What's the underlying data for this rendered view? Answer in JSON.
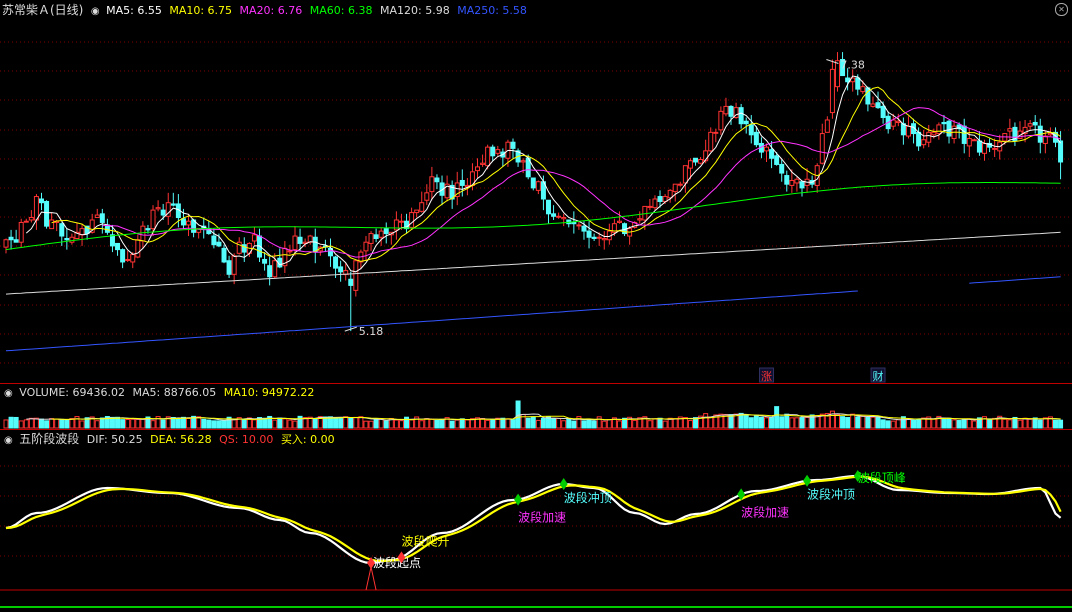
{
  "main_header": {
    "title": "苏常柴Ａ(日线)",
    "items": [
      {
        "label": "MA5: 6.55",
        "color": "#ffffff"
      },
      {
        "label": "MA10: 6.75",
        "color": "#ffff00"
      },
      {
        "label": "MA20: 6.76",
        "color": "#ff33ff"
      },
      {
        "label": "MA60: 6.38",
        "color": "#00ff00"
      },
      {
        "label": "MA120: 5.98",
        "color": "#dcdcdc"
      },
      {
        "label": "MA250: 5.58",
        "color": "#3355ff"
      }
    ]
  },
  "volume_header": {
    "items": [
      {
        "label": "VOLUME: 69436.02",
        "color": "#dcdcdc"
      },
      {
        "label": "MA5: 88766.05",
        "color": "#dcdcdc"
      },
      {
        "label": "MA10: 94972.22",
        "color": "#ffff00"
      }
    ]
  },
  "indicator_header": {
    "title": "五阶段波段",
    "items": [
      {
        "label": "DIF: 50.25",
        "color": "#dcdcdc"
      },
      {
        "label": "DEA: 56.28",
        "color": "#ffff00"
      },
      {
        "label": "QS: 10.00",
        "color": "#ff3333"
      },
      {
        "label": "买入: 0.00",
        "color": "#ffff00"
      }
    ]
  },
  "colors": {
    "up": "#ff3333",
    "down": "#54fcfc",
    "grid": "#800000",
    "divider": "#c00000"
  },
  "chart_data": [
    {
      "type": "candlestick",
      "title": "苏常柴Ａ(日线)",
      "ylim": [
        4.8,
        7.7
      ],
      "series": [
        {
          "name": "MA5",
          "values": []
        },
        {
          "name": "MA10",
          "values": []
        },
        {
          "name": "MA20",
          "values": []
        },
        {
          "name": "MA60",
          "values": []
        },
        {
          "name": "MA120",
          "values": []
        },
        {
          "name": "MA250",
          "values": []
        }
      ],
      "annotations": [
        {
          "text": "7.38",
          "kind": "high"
        },
        {
          "text": "5.18",
          "kind": "low"
        },
        {
          "text": "涨",
          "kind": "event"
        },
        {
          "text": "财",
          "kind": "event"
        }
      ]
    },
    {
      "type": "bar",
      "title": "VOLUME",
      "ylim": [
        0,
        320000
      ],
      "series": [
        {
          "name": "VOLUME",
          "values": []
        },
        {
          "name": "MA5",
          "values": []
        },
        {
          "name": "MA10",
          "values": []
        }
      ]
    },
    {
      "type": "line",
      "title": "五阶段波段",
      "ylim": [
        -20,
        120
      ],
      "series": [
        {
          "name": "DIF",
          "values": []
        },
        {
          "name": "DEA",
          "values": []
        }
      ],
      "annotations": [
        {
          "text": "波段起点",
          "kind": "stage"
        },
        {
          "text": "波段爬升",
          "kind": "stage"
        },
        {
          "text": "波段加速",
          "kind": "stage"
        },
        {
          "text": "波段冲顶",
          "kind": "stage"
        },
        {
          "text": "波段加速",
          "kind": "stage"
        },
        {
          "text": "波段冲顶",
          "kind": "stage"
        },
        {
          "text": "波段顶峰",
          "kind": "stage"
        }
      ]
    }
  ]
}
